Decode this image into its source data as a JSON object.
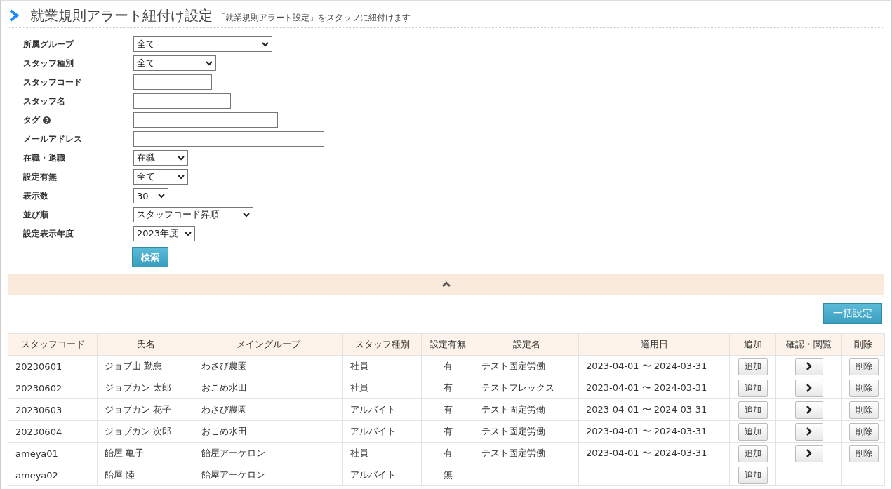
{
  "header": {
    "title": "就業規則アラート紐付け設定",
    "subtitle": "「就業規則アラート設定」をスタッフに紐付けます"
  },
  "filters": [
    {
      "label": "所属グループ",
      "kind": "select",
      "value": "全て"
    },
    {
      "label": "スタッフ種別",
      "kind": "select",
      "value": "全て"
    },
    {
      "label": "スタッフコード",
      "kind": "input"
    },
    {
      "label": "スタッフ名",
      "kind": "input"
    },
    {
      "label": "タグ",
      "kind": "input",
      "help": true
    },
    {
      "label": "メールアドレス",
      "kind": "input"
    },
    {
      "label": "在職・退職",
      "kind": "select",
      "value": "在職"
    },
    {
      "label": "設定有無",
      "kind": "select",
      "value": "全て"
    },
    {
      "label": "表示数",
      "kind": "select",
      "value": "30"
    },
    {
      "label": "並び順",
      "kind": "select",
      "value": "スタッフコード昇順"
    },
    {
      "label": "設定表示年度",
      "kind": "select",
      "value": "2023年度"
    }
  ],
  "search_button": "検索",
  "bulk_button": "一括設定",
  "table": {
    "columns": [
      "スタッフコード",
      "氏名",
      "メイングループ",
      "スタッフ種別",
      "設定有無",
      "設定名",
      "適用日",
      "追加",
      "確認・閲覧",
      "削除"
    ],
    "rows": [
      {
        "cells": [
          "20230601",
          "ジョブ山 勤怠",
          "わさび農園",
          "社員",
          "有",
          "テスト固定労働",
          "2023-04-01 〜 2024-03-31"
        ],
        "add": "追加",
        "view": {
          "kind": "button"
        },
        "delete": {
          "kind": "button",
          "text": "削除"
        }
      },
      {
        "cells": [
          "20230602",
          "ジョブカン 太郎",
          "おこめ水田",
          "社員",
          "有",
          "テストフレックス",
          "2023-04-01 〜 2024-03-31"
        ],
        "add": "追加",
        "view": {
          "kind": "button"
        },
        "delete": {
          "kind": "button",
          "text": "削除"
        }
      },
      {
        "cells": [
          "20230603",
          "ジョブカン 花子",
          "わさび農園",
          "アルバイト",
          "有",
          "テスト固定労働",
          "2023-04-01 〜 2024-03-31"
        ],
        "add": "追加",
        "view": {
          "kind": "button"
        },
        "delete": {
          "kind": "button",
          "text": "削除"
        }
      },
      {
        "cells": [
          "20230604",
          "ジョブカン 次郎",
          "おこめ水田",
          "アルバイト",
          "有",
          "テスト固定労働",
          "2023-04-01 〜 2024-03-31"
        ],
        "add": "追加",
        "view": {
          "kind": "button"
        },
        "delete": {
          "kind": "button",
          "text": "削除"
        }
      },
      {
        "cells": [
          "ameya01",
          "飴屋 亀子",
          "飴屋アーケロン",
          "社員",
          "有",
          "テスト固定労働",
          "2023-04-01 〜 2024-03-31"
        ],
        "add": "追加",
        "view": {
          "kind": "button"
        },
        "delete": {
          "kind": "button",
          "text": "削除"
        }
      },
      {
        "cells": [
          "ameya02",
          "飴屋 陸",
          "飴屋アーケロン",
          "アルバイト",
          "無",
          "",
          ""
        ],
        "add": "追加",
        "view": {
          "kind": "dash",
          "text": "-"
        },
        "delete": {
          "kind": "dash",
          "text": "-"
        }
      }
    ]
  }
}
